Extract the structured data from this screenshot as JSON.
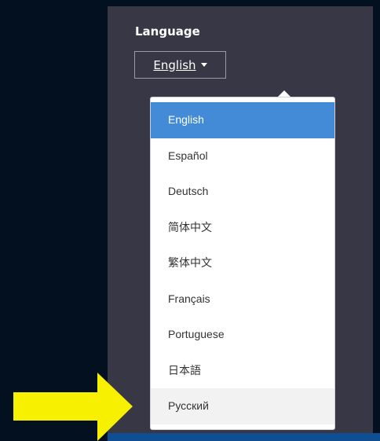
{
  "language": {
    "heading": "Language",
    "current": "English",
    "options": [
      "English",
      "Español",
      "Deutsch",
      "简体中文",
      "繁体中文",
      "Français",
      "Portuguese",
      "日本語",
      "Русский"
    ],
    "selected_index": 0,
    "hovered_index": 8
  },
  "icons": {
    "social": "twitter-icon",
    "pointer": "arrow-right-icon",
    "dropdown": "chevron-down-icon"
  },
  "colors": {
    "background": "#03101f",
    "panel": "#373746",
    "selected": "#438bd6",
    "arrow": "#f7f000",
    "bottom_bar": "#0e4f93"
  }
}
